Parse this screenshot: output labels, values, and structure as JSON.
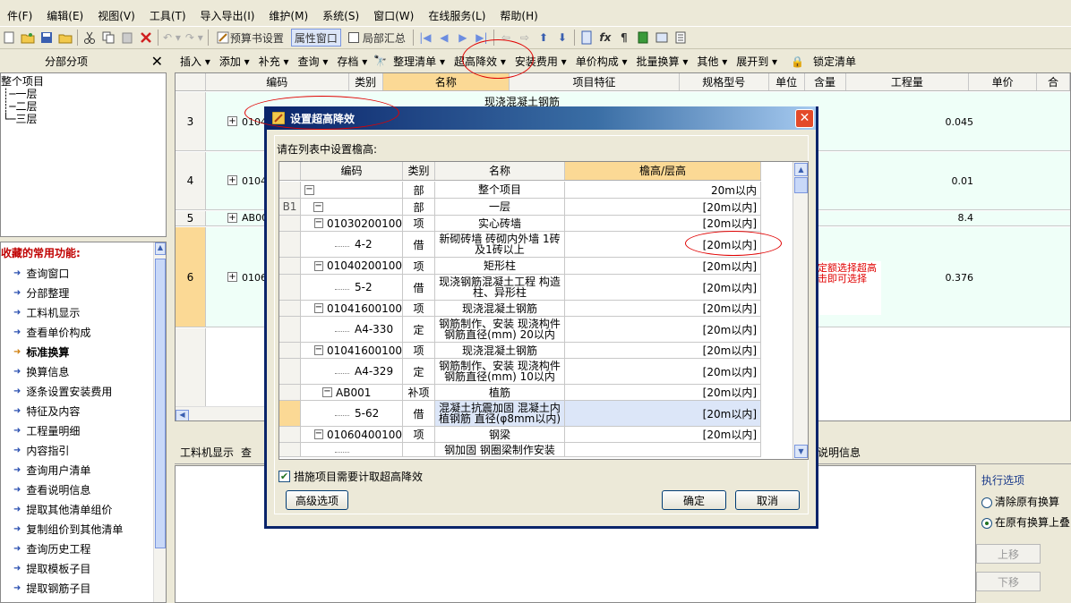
{
  "menu": [
    "件(F)",
    "编辑(E)",
    "视图(V)",
    "工具(T)",
    "导入导出(I)",
    "维护(M)",
    "系统(S)",
    "窗口(W)",
    "在线服务(L)",
    "帮助(H)"
  ],
  "toolbar1": {
    "budget_settings": "预算书设置",
    "property_window": "属性窗口",
    "local_summary": "局部汇总"
  },
  "toolbar2": [
    "插入 ▾",
    "添加 ▾",
    "补充 ▾",
    "查询 ▾",
    "存档 ▾",
    "整理清单 ▾",
    "超高降效 ▾",
    "安装费用 ▾",
    "单价构成 ▾",
    "批量换算 ▾",
    "其他 ▾",
    "展开到 ▾",
    "锁定清单"
  ],
  "left_panel": {
    "title": "分部分项",
    "tree": [
      "整个项目",
      "一层",
      "二层",
      "三层"
    ],
    "favorites_title": "收藏的常用功能:",
    "favorites": [
      "查询窗口",
      "分部整理",
      "工料机显示",
      "查看单价构成",
      "标准换算",
      "换算信息",
      "逐条设置安装费用",
      "特征及内容",
      "工程量明细",
      "内容指引",
      "查询用户清单",
      "查看说明信息",
      "提取其他清单组价",
      "复制组价到其他清单",
      "查询历史工程",
      "提取模板子目",
      "提取钢筋子目"
    ],
    "favorites_bold_index": 4
  },
  "main_grid": {
    "headers": [
      "编码",
      "类别",
      "名称",
      "项目特征",
      "规格型号",
      "单位",
      "含量",
      "工程量",
      "单价",
      "合"
    ],
    "rows": [
      {
        "num": "3",
        "code": "0104",
        "feature": "现浇混凝土钢筋",
        "qty": "0.045"
      },
      {
        "num": "4",
        "code": "0104",
        "feature": "",
        "qty": "0.01"
      },
      {
        "num": "5",
        "code": "AB00",
        "feature": "",
        "qty": "8.4"
      },
      {
        "num": "6",
        "code": "0106",
        "feature": "",
        "qty": "0.376"
      }
    ]
  },
  "bottom_tabs": {
    "first": "工料机显示",
    "second": "查",
    "last": "说明信息"
  },
  "exec_options": {
    "title": "执行选项",
    "opt1": "清除原有换算",
    "opt2": "在原有换算上叠",
    "up": "上移",
    "down": "下移"
  },
  "dialog": {
    "title": "设置超高降效",
    "prompt": "请在列表中设置檐高:",
    "headers": [
      "编码",
      "类别",
      "名称",
      "檐高/层高"
    ],
    "rows": [
      {
        "lead": "",
        "code": "",
        "type": "部",
        "name": "整个项目",
        "value": "20m以内"
      },
      {
        "lead": "B1",
        "code": "",
        "type": "部",
        "name": "一层",
        "value": "[20m以内]"
      },
      {
        "lead": "",
        "code": "01030200100",
        "type": "项",
        "name": "实心砖墙",
        "value": "[20m以内]"
      },
      {
        "lead": "",
        "code": "4-2",
        "type": "借",
        "name": "新砌砖墙 砖砌内外墙 1砖及1砖以上",
        "value": "[20m以内]"
      },
      {
        "lead": "",
        "code": "01040200100",
        "type": "项",
        "name": "矩形柱",
        "value": "[20m以内]"
      },
      {
        "lead": "",
        "code": "5-2",
        "type": "借",
        "name": "现浇钢筋混凝土工程 构造柱、异形柱",
        "value": "[20m以内]"
      },
      {
        "lead": "",
        "code": "01041600100",
        "type": "项",
        "name": "现浇混凝土钢筋",
        "value": "[20m以内]"
      },
      {
        "lead": "",
        "code": "A4-330",
        "type": "定",
        "name": "钢筋制作、安装 现浇构件钢筋直径(mm) 20以内",
        "value": "[20m以内]"
      },
      {
        "lead": "",
        "code": "01041600100",
        "type": "项",
        "name": "现浇混凝土钢筋",
        "value": "[20m以内]"
      },
      {
        "lead": "",
        "code": "A4-329",
        "type": "定",
        "name": "钢筋制作、安装 现浇构件钢筋直径(mm) 10以内",
        "value": "[20m以内]"
      },
      {
        "lead": "",
        "code": "AB001",
        "type": "补项",
        "name": "植筋",
        "value": "[20m以内]"
      },
      {
        "lead": "",
        "code": "5-62",
        "type": "借",
        "name": "混凝土抗震加固 混凝土内植钢筋 直径(φ8mm以内)",
        "value": "[20m以内]"
      },
      {
        "lead": "",
        "code": "01060400100",
        "type": "项",
        "name": "钢梁",
        "value": "[20m以内]"
      },
      {
        "lead": "",
        "code": "",
        "type": "",
        "name": "钢加固 钢圈梁制作安装",
        "value": ""
      }
    ],
    "checkbox_label": "措施项目需要计取超高降效",
    "advanced": "高级选项",
    "ok": "确定",
    "cancel": "取消"
  },
  "annotation": "相应的超高定额选择超高的范围，双击即可选择"
}
